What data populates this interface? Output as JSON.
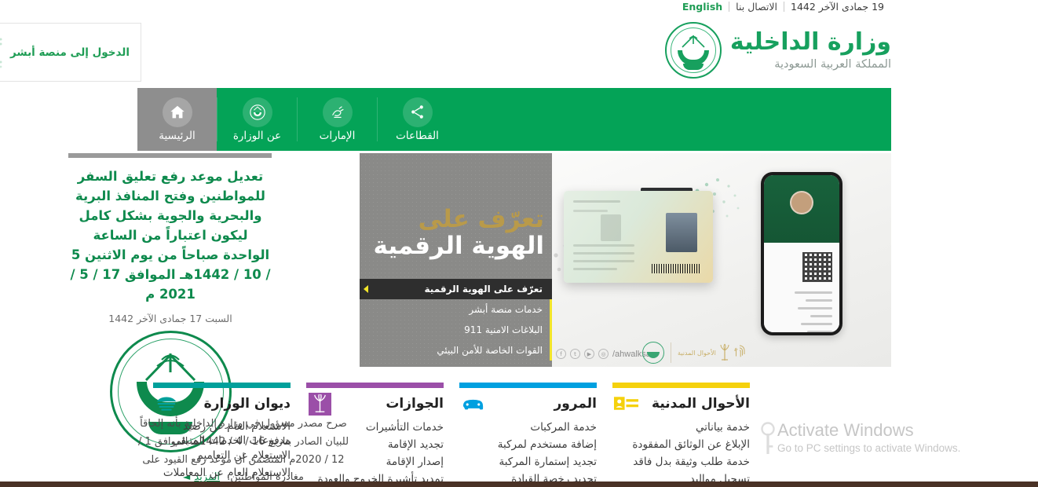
{
  "topbar": {
    "hijri_date": "19 جمادى الآخر 1442",
    "contact_label": "الاتصال بنا",
    "english_label": "English"
  },
  "header": {
    "logo_title": "وزارة الداخلية",
    "logo_subtitle": "المملكة العربية السعودية",
    "absher_label": "الدخول إلى منصة أبشر"
  },
  "nav": {
    "items": [
      {
        "label": "الرئيسية",
        "icon": "home-icon",
        "active": true
      },
      {
        "label": "عن الوزارة",
        "icon": "emblem-icon",
        "active": false
      },
      {
        "label": "الإمارات",
        "icon": "calligraphy-icon",
        "active": false
      },
      {
        "label": "القطاعات",
        "icon": "network-share-icon",
        "active": false
      }
    ]
  },
  "news": {
    "headline": "تعديل موعد رفع تعليق السفر للمواطنين وفتح المنافذ البرية والبحرية والجوية بشكل كامل ليكون اعتباراً من الساعة الواحدة صباحاً من يوم الاثنين 5 / 10 / 1442هـ الموافق 17 / 5 / 2021 م",
    "date": "السبت 17 جمادى الآخر 1442",
    "body": "صرح مصدر مسؤول في وزارة الداخلية بأنه إلحاقاً للبيان الصادر بتاريخ 16 / 4 / 1442هـ الموافق 1 / 12 / 2020م المتضمن أن موعد رفع القيود على مغادرة المواطنين.",
    "more_label": "المزيد"
  },
  "hero": {
    "title_line1": "تعرّف على",
    "title_line2": "الهوية الرقمية",
    "social_handle": "/ahwalksa",
    "brand_label": "الأحوال المدنية",
    "slides": [
      {
        "label": "تعرّف على الهوية الرقمية",
        "active": true
      },
      {
        "label": "خدمات منصة أبشر",
        "active": false
      },
      {
        "label": "البلاغات الامنية 911",
        "active": false
      },
      {
        "label": "القوات الخاصة للأمن البيئي",
        "active": false
      }
    ],
    "accent_color": "#f2e52a",
    "gold_color": "#b99a4a"
  },
  "cards": [
    {
      "title": "ديوان الوزارة",
      "color": "#00a09b",
      "icon": "diwan-badge-icon",
      "links": [
        "الاستعلام العام عن رصيد مدفوعات الخدمات المتبقي",
        "الاستعلام عن التعاميم",
        "الاستعلام العام عن المعاملات"
      ]
    },
    {
      "title": "الجوازات",
      "color": "#9b4fa8",
      "icon": "passport-palm-icon",
      "links": [
        "خدمات التأشيرات",
        "تجديد الإقامة",
        "إصدار الإقامة",
        "تمديد تأشيرة الخروج والعودة"
      ]
    },
    {
      "title": "المرور",
      "color": "#00a0e0",
      "icon": "car-icon",
      "links": [
        "خدمة المركبات",
        "إضافة مستخدم لمركبة",
        "تجديد إستمارة المركبة",
        "تجديد رخصة القيادة"
      ]
    },
    {
      "title": "الأحوال المدنية",
      "color": "#f5d10c",
      "icon": "id-card-icon",
      "links": [
        "خدمة بياناتي",
        "الإبلاغ عن الوثائق المفقودة",
        "خدمة طلب وثيقة بدل فاقد",
        "تسجيل مواليد"
      ]
    }
  ],
  "watermark": {
    "line1": "Activate Windows",
    "line2": "Go to PC settings to activate Windows."
  }
}
